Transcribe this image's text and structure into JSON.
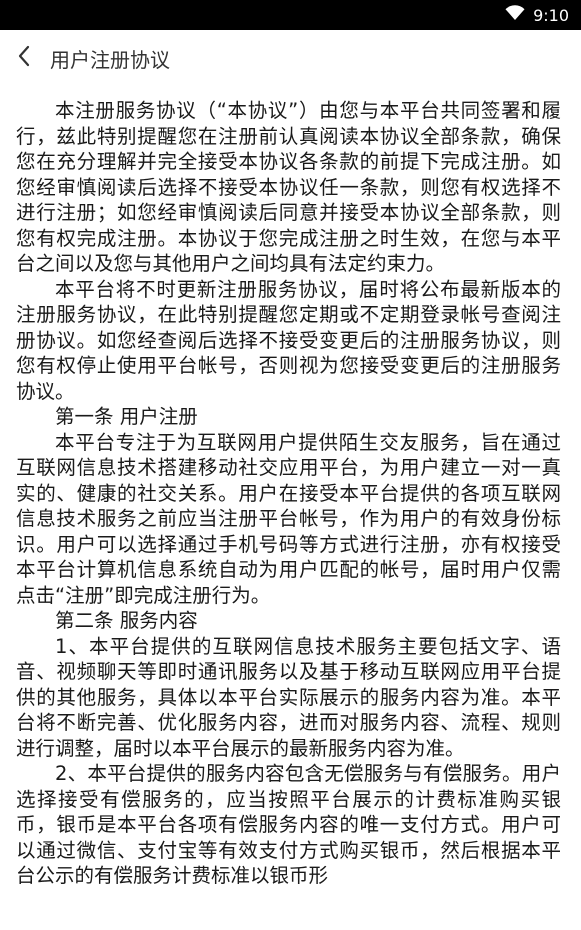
{
  "status_bar": {
    "time": "9:10",
    "wifi_icon": "wifi-icon"
  },
  "header": {
    "back_icon": "chevron-left-icon",
    "title": "用户注册协议"
  },
  "agreement": {
    "paragraphs": [
      "本注册服务协议（“本协议”）由您与本平台共同签署和履行，兹此特别提醒您在注册前认真阅读本协议全部条款，确保您在充分理解并完全接受本协议各条款的前提下完成注册。如您经审慎阅读后选择不接受本协议任一条款，则您有权选择不进行注册；如您经审慎阅读后同意并接受本协议全部条款，则您有权完成注册。本协议于您完成注册之时生效，在您与本平台之间以及您与其他用户之间均具有法定约束力。",
      "本平台将不时更新注册服务协议，届时将公布最新版本的注册服务协议，在此特别提醒您定期或不定期登录帐号查阅注册协议。如您经查阅后选择不接受变更后的注册服务协议，则您有权停止使用平台帐号，否则视为您接受变更后的注册服务协议。",
      "第一条 用户注册",
      "本平台专注于为互联网用户提供陌生交友服务，旨在通过互联网信息技术搭建移动社交应用平台，为用户建立一对一真实的、健康的社交关系。用户在接受本平台提供的各项互联网信息技术服务之前应当注册平台帐号，作为用户的有效身份标识。用户可以选择通过手机号码等方式进行注册，亦有权接受本平台计算机信息系统自动为用户匹配的帐号，届时用户仅需点击“注册”即完成注册行为。",
      "第二条 服务内容",
      "1、本平台提供的互联网信息技术服务主要包括文字、语音、视频聊天等即时通讯服务以及基于移动互联网应用平台提供的其他服务，具体以本平台实际展示的服务内容为准。本平台将不断完善、优化服务内容，进而对服务内容、流程、规则进行调整，届时以本平台展示的最新服务内容为准。",
      "2、本平台提供的服务内容包含无偿服务与有偿服务。用户选择接受有偿服务的，应当按照平台展示的计费标准购买银币，银币是本平台各项有偿服务内容的唯一支付方式。用户可以通过微信、支付宝等有效支付方式购买银币，然后根据本平台公示的有偿服务计费标准以银币形"
    ]
  }
}
